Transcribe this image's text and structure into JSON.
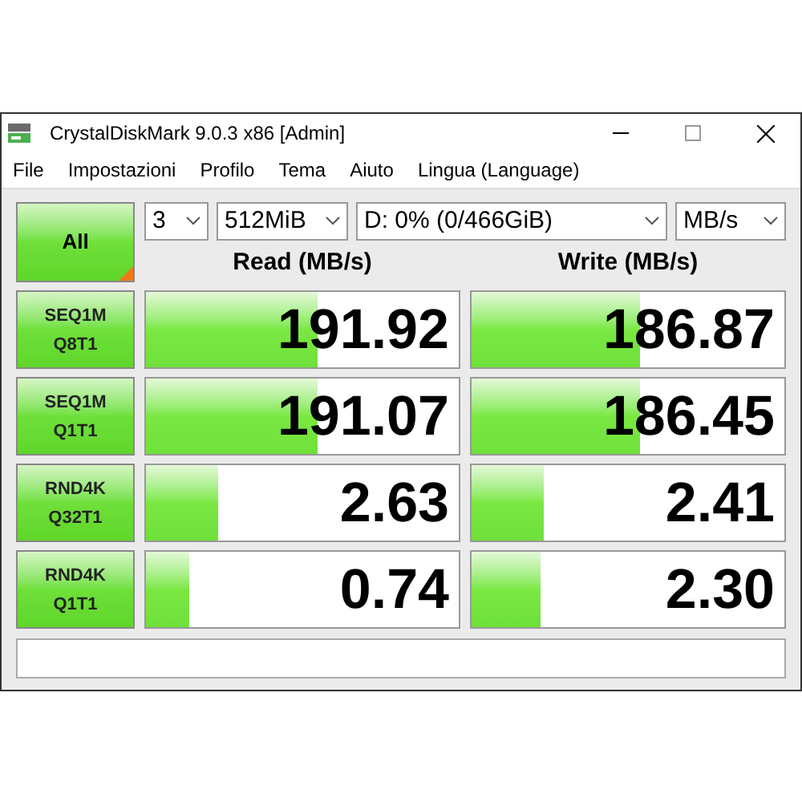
{
  "window": {
    "title": "CrystalDiskMark 9.0.3 x86 [Admin]"
  },
  "menu": [
    "File",
    "Impostazioni",
    "Profilo",
    "Tema",
    "Aiuto",
    "Lingua (Language)"
  ],
  "all_button": {
    "label": "All"
  },
  "selectors": [
    {
      "value": "3"
    },
    {
      "value": "512MiB"
    },
    {
      "value": "D: 0% (0/466GiB)"
    },
    {
      "value": "MB/s"
    }
  ],
  "headers": [
    "Read (MB/s)",
    "Write (MB/s)"
  ],
  "tests": [
    {
      "line1": "SEQ1M",
      "line2": "Q8T1",
      "read": {
        "value": "191.92",
        "level": 0.55
      },
      "write": {
        "value": "186.87",
        "level": 0.54
      }
    },
    {
      "line1": "SEQ1M",
      "line2": "Q1T1",
      "read": {
        "value": "191.07",
        "level": 0.55
      },
      "write": {
        "value": "186.45",
        "level": 0.54
      }
    },
    {
      "line1": "RND4K",
      "line2": "Q32T1",
      "read": {
        "value": "2.63",
        "level": 0.23
      },
      "write": {
        "value": "2.41",
        "level": 0.23
      }
    },
    {
      "line1": "RND4K",
      "line2": "Q1T1",
      "read": {
        "value": "0.74",
        "level": 0.14
      },
      "write": {
        "value": "2.30",
        "level": 0.22
      }
    }
  ]
}
